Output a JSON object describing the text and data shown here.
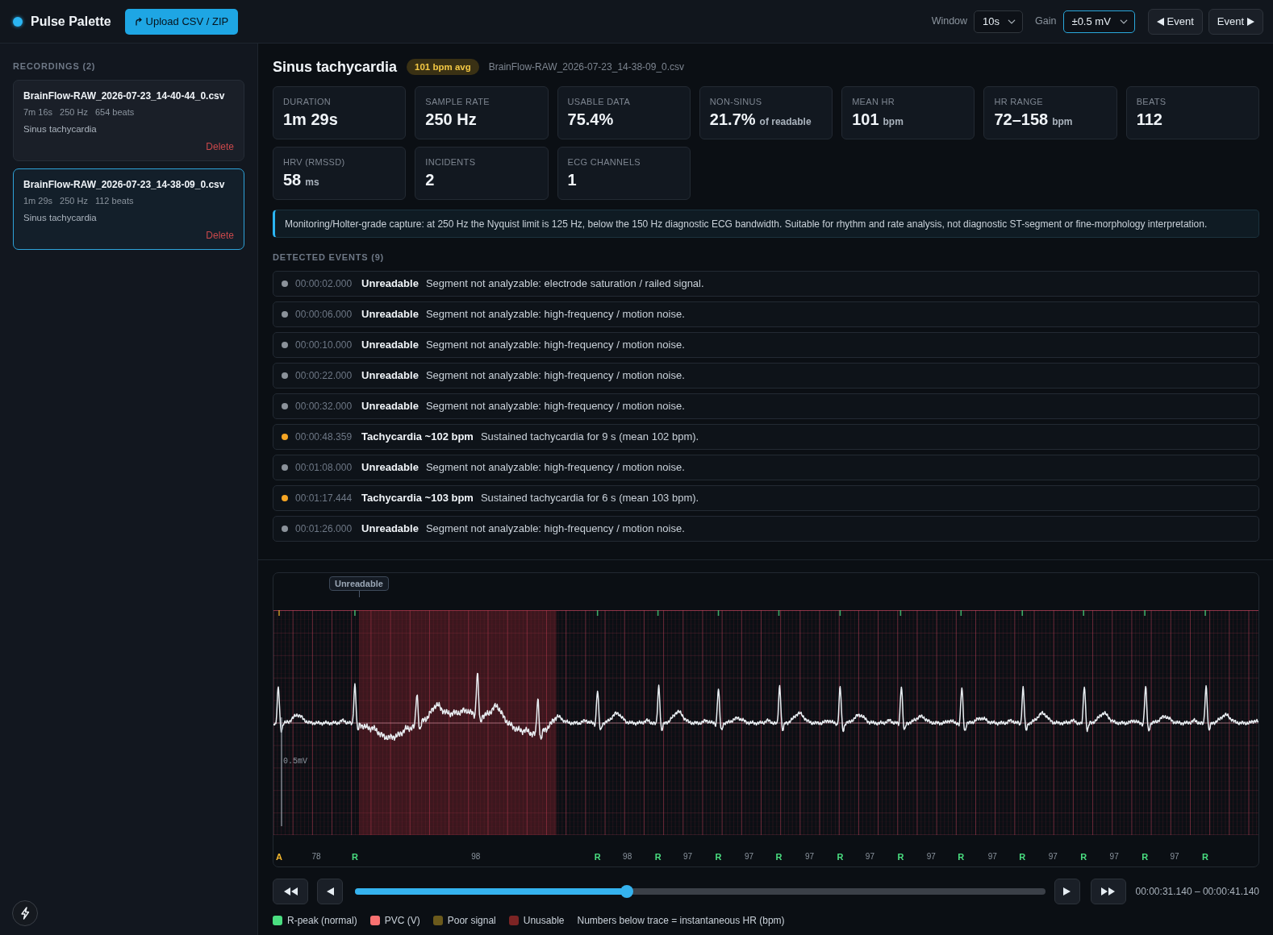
{
  "app": {
    "title": "Pulse Palette",
    "upload_button": "Upload CSV / ZIP"
  },
  "toolbar": {
    "selects": [
      {
        "label": "Window",
        "value": "10s",
        "focused": false
      },
      {
        "label": "Gain",
        "value": "±0.5 mV",
        "focused": true
      }
    ],
    "event_buttons": [
      {
        "kind": "previous",
        "label": "Event"
      },
      {
        "kind": "next",
        "label": "Event"
      }
    ]
  },
  "sidebar": {
    "heading": "RECORDINGS (2)",
    "recordings": [
      {
        "name": "BrainFlow-RAW_2026-07-23_14-40-44_0.csv",
        "duration": "7m 16s",
        "sample_rate": "250 Hz",
        "beats": "654 beats",
        "rhythm": "Sinus tachycardia",
        "delete": "Delete",
        "selected": false
      },
      {
        "name": "BrainFlow-RAW_2026-07-23_14-38-09_0.csv",
        "duration": "1m 29s",
        "sample_rate": "250 Hz",
        "beats": "112 beats",
        "rhythm": "Sinus tachycardia",
        "delete": "Delete",
        "selected": true
      }
    ]
  },
  "summary": {
    "title": "Sinus tachycardia",
    "badge": "101 bpm avg",
    "file": "BrainFlow-RAW_2026-07-23_14-38-09_0.csv"
  },
  "stats": [
    {
      "label": "DURATION",
      "value": "1m 29s"
    },
    {
      "label": "SAMPLE RATE",
      "value": "250 Hz"
    },
    {
      "label": "USABLE DATA",
      "value": "75.4%"
    },
    {
      "label": "NON-SINUS",
      "value": "21.7%",
      "unit": "of readable"
    },
    {
      "label": "MEAN HR",
      "value": "101",
      "unit": "bpm"
    },
    {
      "label": "HR RANGE",
      "value": "72–158",
      "unit": "bpm"
    },
    {
      "label": "BEATS",
      "value": "112"
    },
    {
      "label": "HRV (RMSSD)",
      "value": "58",
      "unit": "ms"
    },
    {
      "label": "INCIDENTS",
      "value": "2"
    },
    {
      "label": "ECG CHANNELS",
      "value": "1"
    }
  ],
  "notice": "Monitoring/Holter-grade capture: at 250 Hz the Nyquist limit is 125 Hz, below the 150 Hz diagnostic ECG bandwidth. Suitable for rhythm and rate analysis, not diagnostic ST-segment or fine-morphology interpretation.",
  "events": {
    "heading": "DETECTED EVENTS (9)",
    "items": [
      {
        "color": "#8b929a",
        "time": "00:00:02.000",
        "title": "Unreadable",
        "description": "Segment not analyzable: electrode saturation / railed signal."
      },
      {
        "color": "#8b929a",
        "time": "00:00:06.000",
        "title": "Unreadable",
        "description": "Segment not analyzable: high-frequency / motion noise."
      },
      {
        "color": "#8b929a",
        "time": "00:00:10.000",
        "title": "Unreadable",
        "description": "Segment not analyzable: high-frequency / motion noise."
      },
      {
        "color": "#8b929a",
        "time": "00:00:22.000",
        "title": "Unreadable",
        "description": "Segment not analyzable: high-frequency / motion noise."
      },
      {
        "color": "#8b929a",
        "time": "00:00:32.000",
        "title": "Unreadable",
        "description": "Segment not analyzable: high-frequency / motion noise."
      },
      {
        "color": "#f5a524",
        "time": "00:00:48.359",
        "title": "Tachycardia ~102 bpm",
        "description": "Sustained tachycardia for 9 s (mean 102 bpm)."
      },
      {
        "color": "#8b929a",
        "time": "00:01:08.000",
        "title": "Unreadable",
        "description": "Segment not analyzable: high-frequency / motion noise."
      },
      {
        "color": "#f5a524",
        "time": "00:01:17.444",
        "title": "Tachycardia ~103 bpm",
        "description": "Sustained tachycardia for 6 s (mean 103 bpm)."
      },
      {
        "color": "#8b929a",
        "time": "00:01:26.000",
        "title": "Unreadable",
        "description": "Segment not analyzable: high-frequency / motion noise."
      }
    ]
  },
  "strip": {
    "annotations": [
      {
        "label": "Unreadable"
      }
    ],
    "scale_label": "0.5mV",
    "markers": [
      {
        "kind": "beat",
        "label": "A",
        "color": "#f5b82e"
      },
      {
        "kind": "rate",
        "label": "78"
      },
      {
        "kind": "beat",
        "label": "R",
        "color": "#4ade80"
      },
      {
        "kind": "rate",
        "label": "98"
      },
      {
        "kind": "beat",
        "label": "R",
        "color": "#4ade80"
      },
      {
        "kind": "rate",
        "label": "98"
      },
      {
        "kind": "beat",
        "label": "R",
        "color": "#4ade80"
      },
      {
        "kind": "rate",
        "label": "97"
      },
      {
        "kind": "beat",
        "label": "R",
        "color": "#4ade80"
      },
      {
        "kind": "rate",
        "label": "97"
      },
      {
        "kind": "beat",
        "label": "R",
        "color": "#4ade80"
      },
      {
        "kind": "rate",
        "label": "97"
      },
      {
        "kind": "beat",
        "label": "R",
        "color": "#4ade80"
      },
      {
        "kind": "rate",
        "label": "97"
      },
      {
        "kind": "beat",
        "label": "R",
        "color": "#4ade80"
      },
      {
        "kind": "rate",
        "label": "97"
      },
      {
        "kind": "beat",
        "label": "R",
        "color": "#4ade80"
      },
      {
        "kind": "rate",
        "label": "97"
      },
      {
        "kind": "beat",
        "label": "R",
        "color": "#4ade80"
      },
      {
        "kind": "rate",
        "label": "97"
      },
      {
        "kind": "beat",
        "label": "R",
        "color": "#4ade80"
      },
      {
        "kind": "rate",
        "label": "97"
      },
      {
        "kind": "beat",
        "label": "R",
        "color": "#4ade80"
      },
      {
        "kind": "rate",
        "label": "97"
      },
      {
        "kind": "beat",
        "label": "R",
        "color": "#4ade80"
      }
    ],
    "playback": {
      "level": 0.394,
      "range": "00:00:31.140 – 00:00:41.140"
    },
    "legend": [
      {
        "kind": "swatch",
        "label": "R-peak (normal)",
        "color": "#4ade80"
      },
      {
        "kind": "swatch",
        "label": "PVC (V)",
        "color": "#f87171"
      },
      {
        "kind": "swatch",
        "label": "Poor signal",
        "color": "#6b5a1c"
      },
      {
        "kind": "swatch",
        "label": "Unusable",
        "color": "#7c2424"
      },
      {
        "kind": "note",
        "label": "Numbers below trace = instantaneous HR (bpm)"
      }
    ]
  }
}
